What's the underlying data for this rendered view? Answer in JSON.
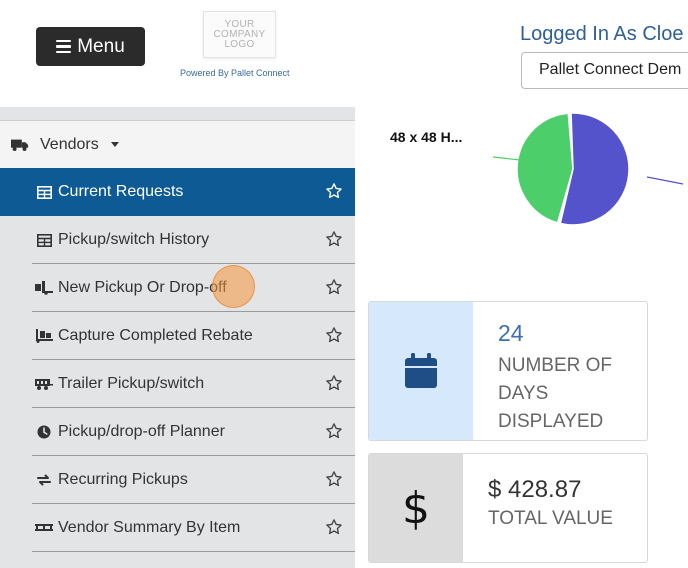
{
  "header": {
    "menu_label": "Menu",
    "logo_lines": [
      "YOUR",
      "COMPANY",
      "LOGO"
    ],
    "powered_by": "Powered By Pallet Connect",
    "logged_in_as": "Logged In As Cloe N",
    "company_select_value": "Pallet Connect Dem"
  },
  "sidebar": {
    "section_label": "Vendors",
    "items": [
      {
        "label": "Current Requests",
        "icon": "table-icon",
        "active": true
      },
      {
        "label": "Pickup/switch History",
        "icon": "table-icon",
        "active": false
      },
      {
        "label": "New Pickup Or Drop-off",
        "icon": "truck-loading-icon",
        "active": false
      },
      {
        "label": "Capture Completed Rebate",
        "icon": "pallet-dolly-icon",
        "active": false
      },
      {
        "label": "Trailer Pickup/switch",
        "icon": "trailer-icon",
        "active": false
      },
      {
        "label": "Pickup/drop-off Planner",
        "icon": "clock-icon",
        "active": false
      },
      {
        "label": "Recurring Pickups",
        "icon": "sync-icon",
        "active": false
      },
      {
        "label": "Vendor Summary By Item",
        "icon": "pallet-icon",
        "active": false
      }
    ]
  },
  "chart_data": {
    "type": "pie",
    "slices": [
      {
        "label": "48 x 48 H...",
        "value": 45,
        "color": "#4ccf6a"
      },
      {
        "label": "",
        "value": 55,
        "color": "#5453cc"
      }
    ]
  },
  "cards": {
    "days": {
      "value": "24",
      "label": "Number of days displayed",
      "icon": "calendar-icon"
    },
    "value": {
      "value": "$ 428.87",
      "label": "Total value",
      "icon_glyph": "$",
      "icon": "dollar-icon"
    }
  },
  "colors": {
    "active_nav": "#0e5a95",
    "sidebar_bg": "#e3e4e6",
    "link_blue": "#2f5f97",
    "calendar_bg": "#d6e8fb"
  }
}
